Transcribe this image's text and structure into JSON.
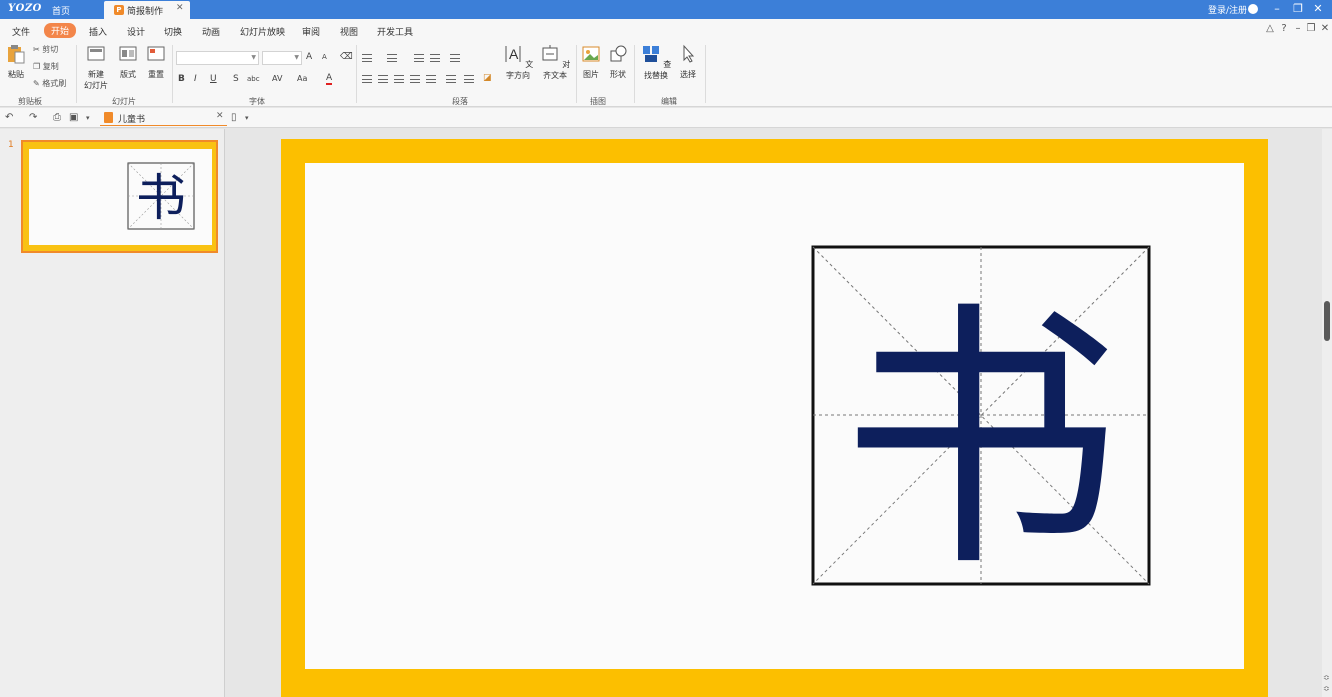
{
  "titlebar": {
    "logo": "YOZO",
    "home_tab": "首页",
    "doc_tab": "简报制作",
    "doc_tab_icon": "P",
    "login": "登录/注册"
  },
  "menu": {
    "items": [
      "文件",
      "开始",
      "插入",
      "设计",
      "切换",
      "动画",
      "幻灯片放映",
      "审阅",
      "视图",
      "开发工具"
    ],
    "active": "开始"
  },
  "ribbon": {
    "clipboard": {
      "paste": "粘贴",
      "cut": "剪切",
      "copy": "复制",
      "format_painter": "格式刷",
      "group": "剪贴板"
    },
    "slides": {
      "new_slide_1": "新建",
      "new_slide_2": "幻灯片",
      "layout": "版式",
      "reset": "重置",
      "group": "幻灯片"
    },
    "font": {
      "group": "字体",
      "bold": "B",
      "italic": "I",
      "underline": "U",
      "strike": "S",
      "shadow": "abc",
      "spacing": "AV",
      "case": "Aa",
      "color": "A",
      "grow": "A",
      "shrink": "A"
    },
    "paragraph": {
      "group": "段落"
    },
    "text": {
      "direction": "文字方向",
      "align_text": "对齐文本"
    },
    "picture": {
      "image": "图片",
      "shape": "形状",
      "group": "插图"
    },
    "editing": {
      "find_replace": "查找替换",
      "select": "选择",
      "group": "编辑"
    }
  },
  "quick_access": {
    "file_name": "儿童书"
  },
  "thumbnails": {
    "slide_number": "1"
  },
  "slide": {
    "character": "书",
    "border_color": "#fcbf00",
    "char_color": "#0d1f5c"
  },
  "colors": {
    "accent": "#f3864a",
    "title_bar": "#3c7fd8"
  }
}
